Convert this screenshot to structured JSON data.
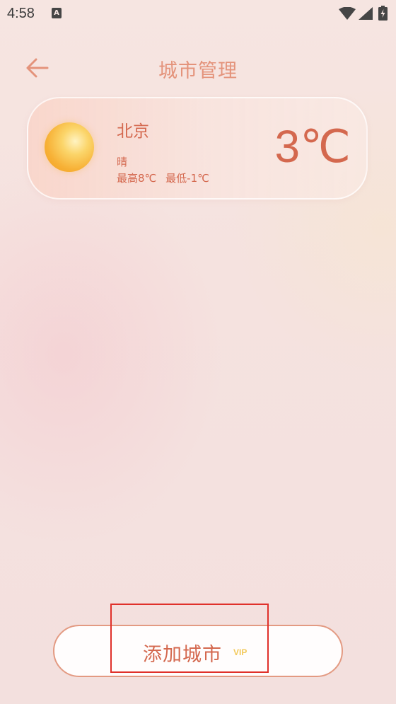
{
  "status_bar": {
    "time": "4:58",
    "notification_icon_letter": "A",
    "icons": [
      "wifi-icon",
      "signal-icon",
      "battery-charging-icon"
    ]
  },
  "header": {
    "back_icon": "arrow-left-icon",
    "title": "城市管理"
  },
  "city_card": {
    "weather_icon": "sun-icon",
    "city": "北京",
    "condition": "晴",
    "high": "最高8℃",
    "low": "最低-1℃",
    "current_temp": "3℃"
  },
  "footer": {
    "add_city_label": "添加城市",
    "vip_badge": "VIP"
  },
  "colors": {
    "accent": "#d4684e",
    "title": "#e4937b",
    "button_border": "#e39a82",
    "vip": "#f2c95b",
    "highlight": "#e0312b"
  }
}
